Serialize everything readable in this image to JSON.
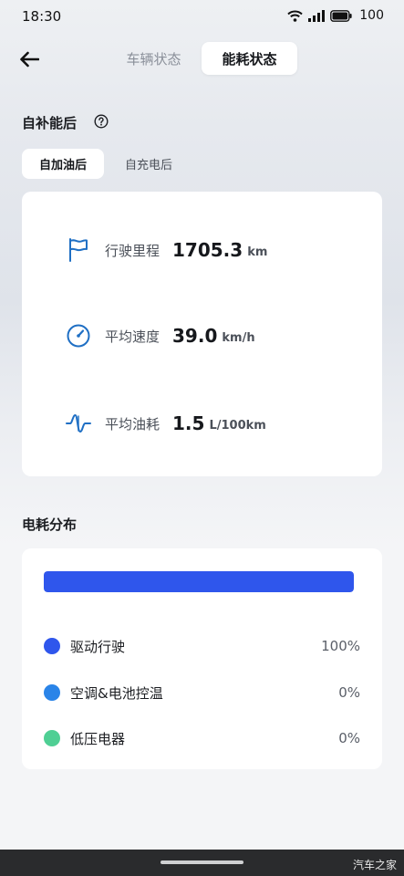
{
  "status_bar": {
    "time": "18:30",
    "battery": "100"
  },
  "header": {
    "tabs": [
      {
        "label": "车辆状态",
        "active": false
      },
      {
        "label": "能耗状态",
        "active": true
      }
    ]
  },
  "refuel_section": {
    "title": "自补能后",
    "chips": [
      {
        "label": "自加油后",
        "active": true
      },
      {
        "label": "自充电后",
        "active": false
      }
    ]
  },
  "stats": [
    {
      "icon": "flag-icon",
      "label": "行驶里程",
      "value": "1705.3",
      "unit": "km"
    },
    {
      "icon": "speedometer-icon",
      "label": "平均速度",
      "value": "39.0",
      "unit": "km/h"
    },
    {
      "icon": "wave-icon",
      "label": "平均油耗",
      "value": "1.5",
      "unit": "L/100km"
    }
  ],
  "distribution": {
    "title": "电耗分布",
    "bar_fill_percent": 100,
    "items": [
      {
        "label": "驱动行驶",
        "value": "100%",
        "color": "#2f56ec"
      },
      {
        "label": "空调&电池控温",
        "value": "0%",
        "color": "#2a84e8"
      },
      {
        "label": "低压电器",
        "value": "0%",
        "color": "#4fcf94"
      }
    ]
  },
  "colors": {
    "accent_blue": "#1f6fc4",
    "bar_blue": "#2f56ec"
  },
  "watermark": "汽车之家"
}
